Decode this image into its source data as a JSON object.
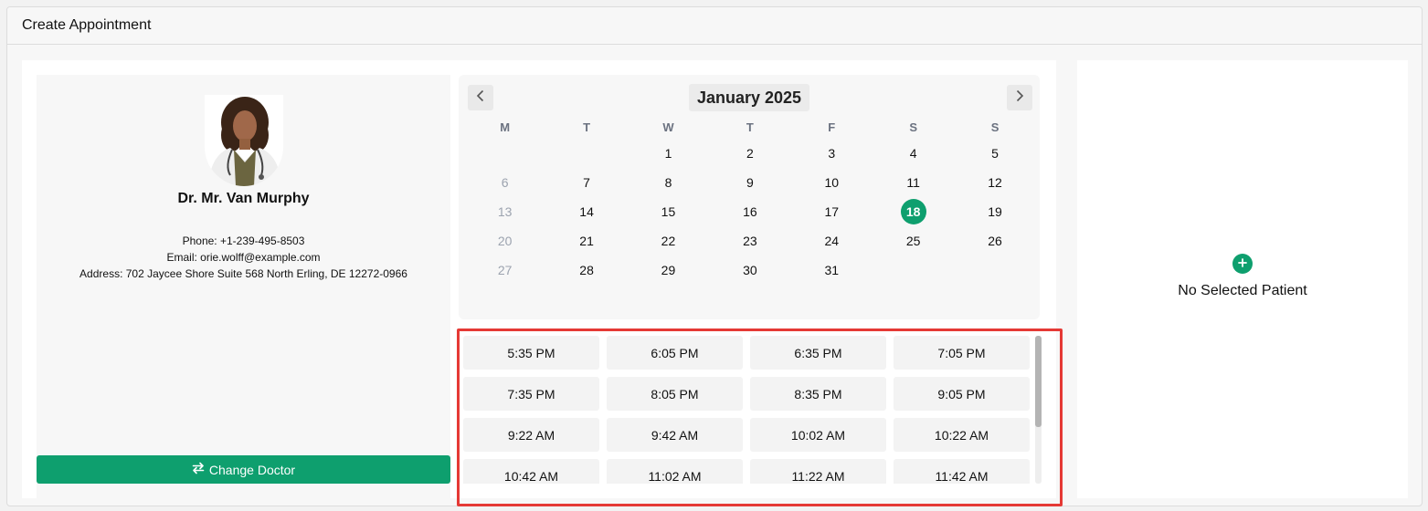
{
  "page": {
    "title": "Create Appointment"
  },
  "doctor": {
    "name": "Dr. Mr. Van Murphy",
    "phone": "Phone: +1-239-495-8503",
    "email": "Email: orie.wolff@example.com",
    "address": "Address: 702 Jaycee Shore Suite 568 North Erling, DE 12272-0966",
    "change_label": "Change Doctor"
  },
  "calendar": {
    "month_label": "January 2025",
    "weekdays": [
      "M",
      "T",
      "W",
      "T",
      "F",
      "S",
      "S"
    ],
    "selected_day": "18",
    "weeks": [
      [
        "",
        "",
        "1",
        "2",
        "3",
        "4",
        "5"
      ],
      [
        "6",
        "7",
        "8",
        "9",
        "10",
        "11",
        "12"
      ],
      [
        "13",
        "14",
        "15",
        "16",
        "17",
        "18",
        "19"
      ],
      [
        "20",
        "21",
        "22",
        "23",
        "24",
        "25",
        "26"
      ],
      [
        "27",
        "28",
        "29",
        "30",
        "31",
        "",
        ""
      ]
    ],
    "muted_days": [
      "6",
      "13",
      "20",
      "27"
    ]
  },
  "time_slots": [
    [
      "5:35 PM",
      "6:05 PM",
      "6:35 PM",
      "7:05 PM"
    ],
    [
      "7:35 PM",
      "8:05 PM",
      "8:35 PM",
      "9:05 PM"
    ],
    [
      "9:22 AM",
      "9:42 AM",
      "10:02 AM",
      "10:22 AM"
    ],
    [
      "10:42 AM",
      "11:02 AM",
      "11:22 AM",
      "11:42 AM"
    ]
  ],
  "patient": {
    "empty_label": "No Selected Patient"
  },
  "colors": {
    "accent": "#0e9f6e",
    "highlight_border": "#e53935"
  }
}
